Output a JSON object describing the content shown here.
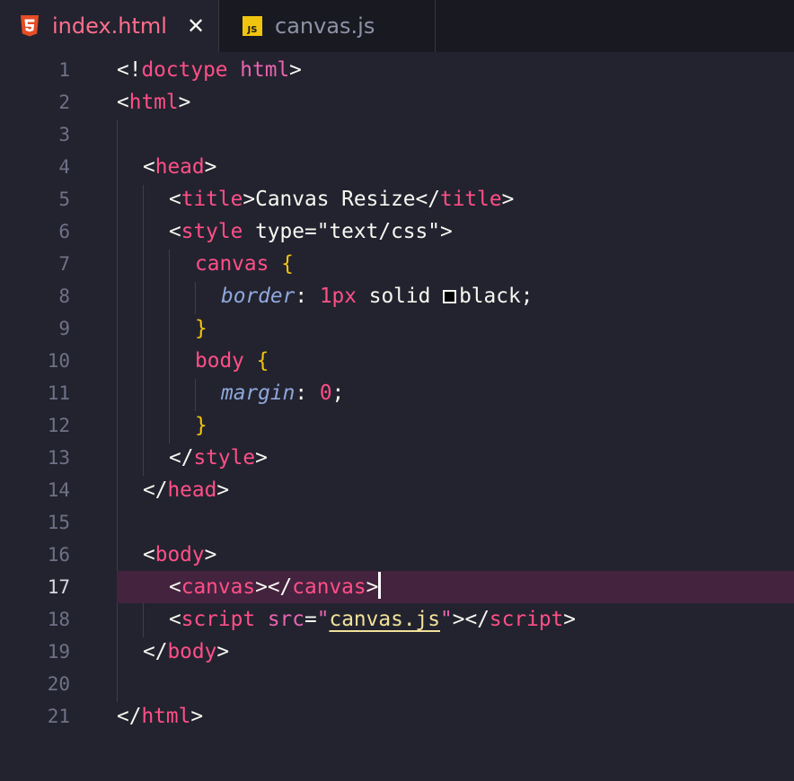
{
  "tabs": [
    {
      "label": "index.html",
      "icon": "html5-icon",
      "active": true
    },
    {
      "label": "canvas.js",
      "icon": "js-icon",
      "badge": "JS",
      "active": false
    }
  ],
  "editor": {
    "active_line": 17,
    "line_numbers": [
      "1",
      "2",
      "3",
      "4",
      "5",
      "6",
      "7",
      "8",
      "9",
      "10",
      "11",
      "12",
      "13",
      "14",
      "15",
      "16",
      "17",
      "18",
      "19",
      "20",
      "21"
    ],
    "code": {
      "l1": {
        "open": "<!",
        "kw": "doctype",
        "sp": " ",
        "name": "html",
        "close": ">"
      },
      "l2": {
        "open": "<",
        "tag": "html",
        "close": ">"
      },
      "l4": {
        "open": "<",
        "tag": "head",
        "close": ">"
      },
      "l5": {
        "open": "<",
        "tag": "title",
        "close": ">",
        "text": "Canvas Resize",
        "open2": "</",
        "tag2": "title",
        "close2": ">"
      },
      "l6": {
        "open": "<",
        "tag": "style",
        "attr": " type",
        "eq": "=",
        "val": "\"text/css\"",
        "close": ">"
      },
      "l7": {
        "sel": "canvas",
        "sp": " ",
        "brace": "{"
      },
      "l8": {
        "prop": "border",
        "colon": ": ",
        "num": "1px",
        "rest": " solid ",
        "value": "black;"
      },
      "l9": {
        "brace": "}"
      },
      "l10": {
        "sel": "body",
        "sp": " ",
        "brace": "{"
      },
      "l11": {
        "prop": "margin",
        "colon": ": ",
        "num": "0",
        "semi": ";"
      },
      "l12": {
        "brace": "}"
      },
      "l13": {
        "open": "</",
        "tag": "style",
        "close": ">"
      },
      "l14": {
        "open": "</",
        "tag": "head",
        "close": ">"
      },
      "l16": {
        "open": "<",
        "tag": "body",
        "close": ">"
      },
      "l17": {
        "open": "<",
        "tag": "canvas",
        "close": ">",
        "open2": "</",
        "tag2": "canvas",
        "close2": ">"
      },
      "l18": {
        "open": "<",
        "tag": "script",
        "attr": " src",
        "eq": "=",
        "q1": "\"",
        "val": "canvas.js",
        "q2": "\"",
        "close": ">",
        "open2": "</",
        "tag2": "script",
        "close2": ">"
      },
      "l19": {
        "open": "</",
        "tag": "body",
        "close": ">"
      },
      "l21": {
        "open": "</",
        "tag": "html",
        "close": ">"
      }
    }
  }
}
